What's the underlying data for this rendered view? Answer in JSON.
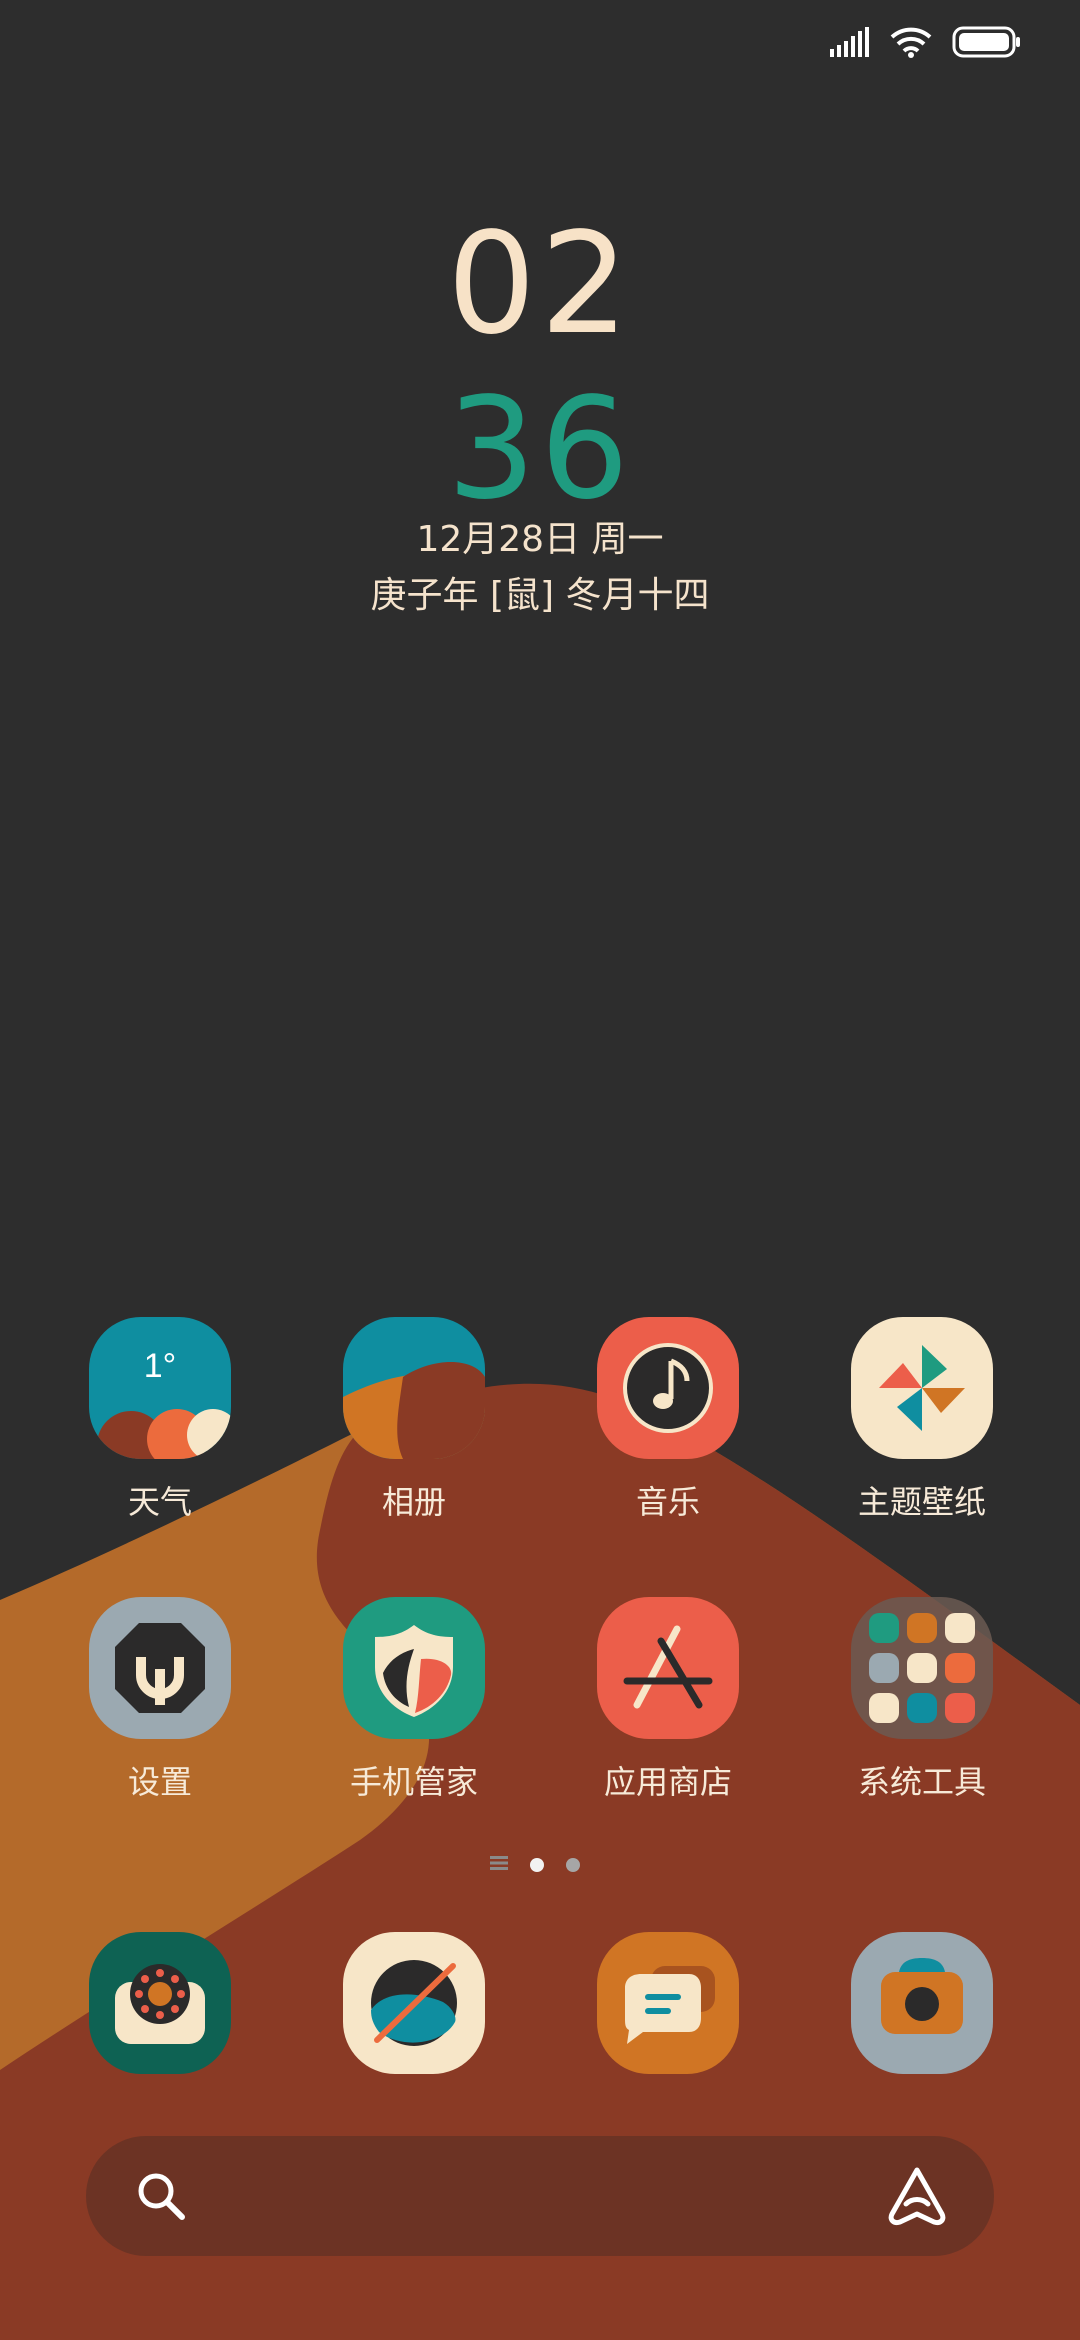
{
  "status_bar": {
    "signal": "signal-icon",
    "wifi": "wifi-icon",
    "battery": "battery-icon"
  },
  "clock": {
    "hour": "02",
    "minute": "36",
    "date": "12月28日  周一",
    "lunar": "庚子年 [鼠] 冬月十四"
  },
  "colors": {
    "background": "#2d2d2d",
    "wallpaper_orange": "#b46a2a",
    "wallpaper_brown": "#8a3a25",
    "hour": "#f7e2c7",
    "minute": "#1f9b80"
  },
  "apps": [
    {
      "name": "weather",
      "label": "天气",
      "icon": "weather-icon",
      "temp": "1°"
    },
    {
      "name": "gallery",
      "label": "相册",
      "icon": "gallery-icon"
    },
    {
      "name": "music",
      "label": "音乐",
      "icon": "music-icon"
    },
    {
      "name": "themes",
      "label": "主题壁纸",
      "icon": "pinwheel-icon"
    },
    {
      "name": "settings",
      "label": "设置",
      "icon": "settings-icon"
    },
    {
      "name": "security",
      "label": "手机管家",
      "icon": "shield-icon"
    },
    {
      "name": "app-store",
      "label": "应用商店",
      "icon": "app-store-icon"
    },
    {
      "name": "system-tools",
      "label": "系统工具",
      "icon": "folder-icon"
    }
  ],
  "page_indicator": {
    "pages": 2,
    "current": 1
  },
  "dock": [
    {
      "name": "phone",
      "icon": "phone-icon"
    },
    {
      "name": "browser",
      "icon": "browser-icon"
    },
    {
      "name": "messages",
      "icon": "messages-icon"
    },
    {
      "name": "camera",
      "icon": "camera-icon"
    }
  ],
  "search_bar": {
    "icon": "search-icon",
    "assistant_icon": "assistant-icon"
  }
}
